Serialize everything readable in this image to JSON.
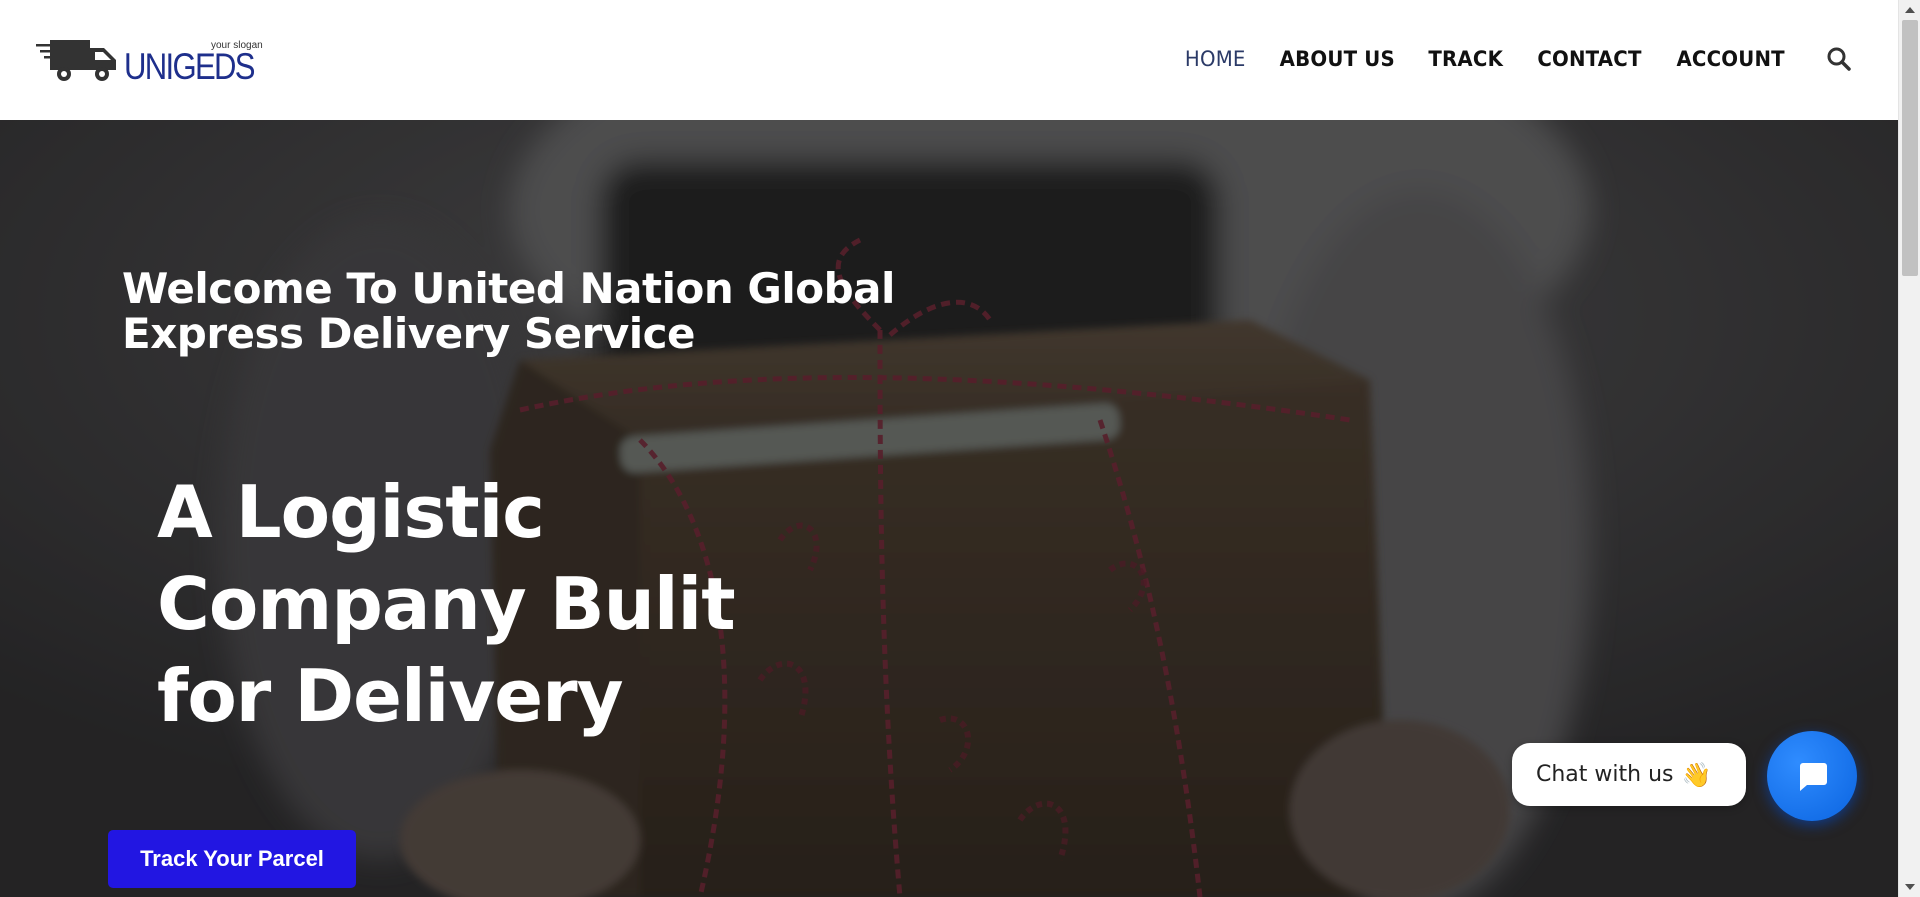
{
  "header": {
    "logo_brand": "UNIGEDS",
    "logo_slogan": "your slogan",
    "nav": [
      {
        "label": "HOME",
        "active": true
      },
      {
        "label": "ABOUT US",
        "active": false
      },
      {
        "label": "TRACK",
        "active": false
      },
      {
        "label": "CONTACT",
        "active": false
      },
      {
        "label": "ACCOUNT",
        "active": false
      }
    ],
    "search_icon": "search-icon"
  },
  "hero": {
    "welcome_line1": "Welcome To United Nation Global",
    "welcome_line2": "Express Delivery Service",
    "title_line1": "A Logistic",
    "title_line2": "Company Bulit",
    "title_line3": "for Delivery",
    "cta_label": "Track Your Parcel"
  },
  "chat": {
    "bubble_text": "Chat with us",
    "wave_icon": "👋",
    "button_icon": "chat-icon"
  },
  "colors": {
    "brand_blue": "#1e2f8c",
    "active_nav": "#2b3a67",
    "cta_button": "#2216e2",
    "chat_button": "#0b64e0"
  }
}
